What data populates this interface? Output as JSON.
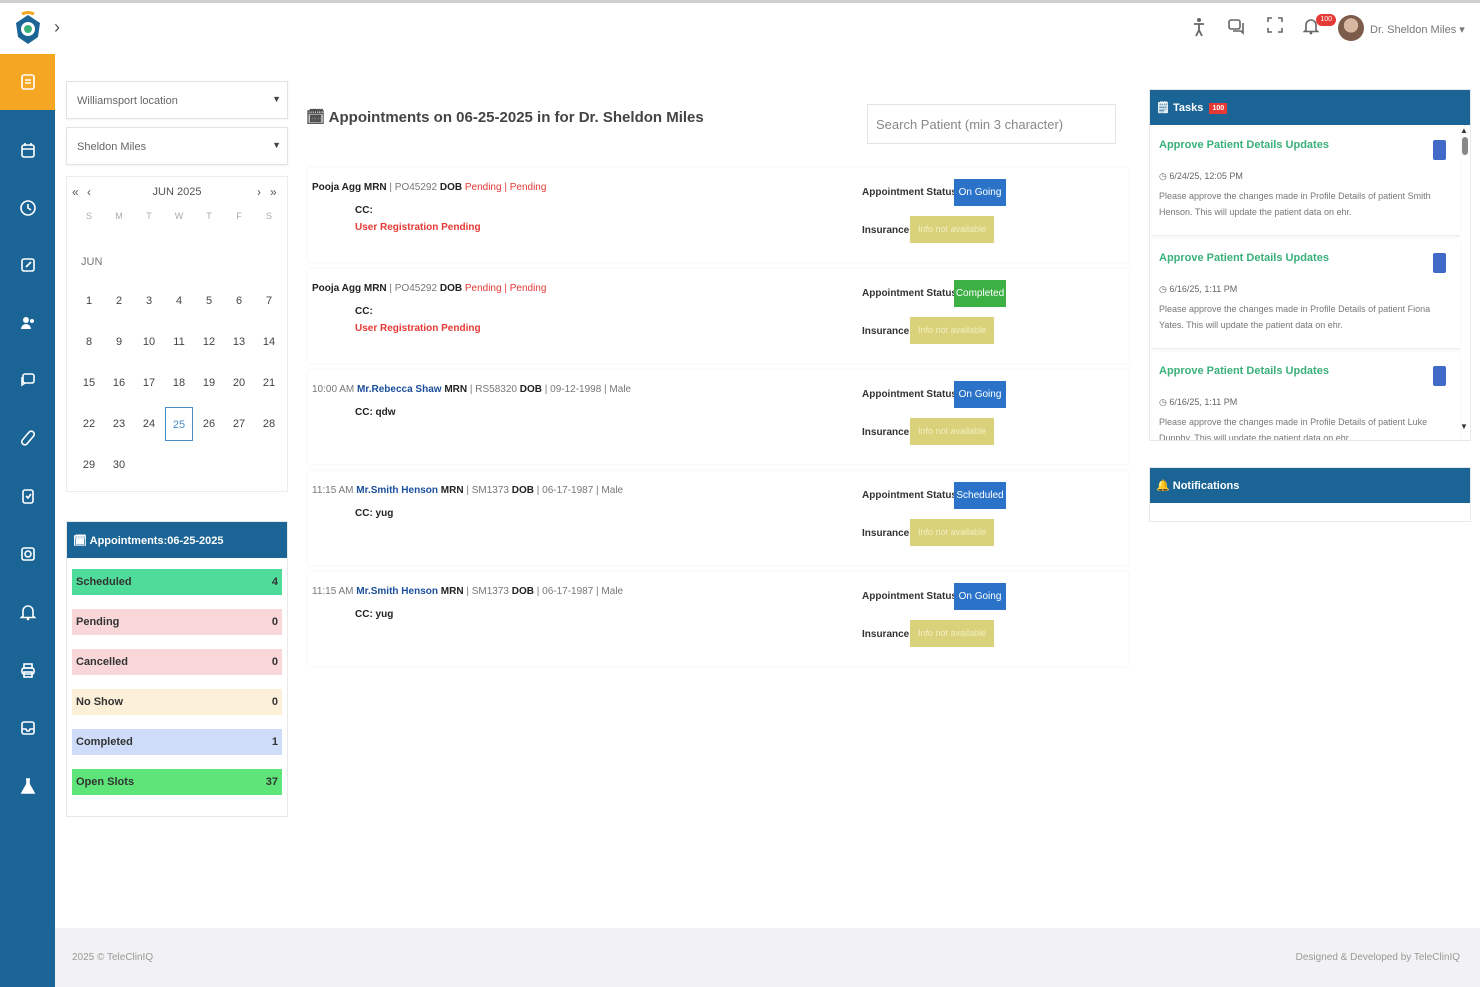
{
  "header": {
    "user_name": "Dr. Sheldon Miles",
    "notification_badge": "100"
  },
  "filters": {
    "location": "Williamsport location",
    "provider": "Sheldon Miles"
  },
  "calendar": {
    "title": "JUN 2025",
    "month_label": "JUN",
    "weekdays": [
      "S",
      "M",
      "T",
      "W",
      "T",
      "F",
      "S"
    ],
    "days": [
      "1",
      "2",
      "3",
      "4",
      "5",
      "6",
      "7",
      "8",
      "9",
      "10",
      "11",
      "12",
      "13",
      "14",
      "15",
      "16",
      "17",
      "18",
      "19",
      "20",
      "21",
      "22",
      "23",
      "24",
      "25",
      "26",
      "27",
      "28",
      "29",
      "30"
    ],
    "selected_day": "25"
  },
  "summary": {
    "title": "Appointments:06-25-2025",
    "rows": [
      {
        "label": "Scheduled",
        "count": "4",
        "color": "#4fdc9b"
      },
      {
        "label": "Pending",
        "count": "0",
        "color": "#f9d6d8"
      },
      {
        "label": "Cancelled",
        "count": "0",
        "color": "#f9d6d8"
      },
      {
        "label": "No Show",
        "count": "0",
        "color": "#fdf0d8"
      },
      {
        "label": "Completed",
        "count": "1",
        "color": "#cfdcf9"
      },
      {
        "label": "Open Slots",
        "count": "37",
        "color": "#5ee57a"
      }
    ]
  },
  "main": {
    "title": "Appointments on 06-25-2025 in for Dr. Sheldon Miles",
    "search_placeholder": "Search Patient (min 3 character)"
  },
  "appointments": [
    {
      "time": "",
      "patient": "Pooja Agg",
      "mrn_label": "MRN",
      "mrn": "| PO45292",
      "dob_label": "DOB",
      "dob": "Pending | Pending",
      "cc": "CC:",
      "note": "User Registration Pending",
      "status_label": "Appointment Status:",
      "status": "On Going",
      "status_color": "#2a73c9",
      "ins_label": "Insurance:",
      "ins": "Info not available"
    },
    {
      "time": "",
      "patient": "Pooja Agg",
      "mrn_label": "MRN",
      "mrn": "| PO45292",
      "dob_label": "DOB",
      "dob": "Pending | Pending",
      "cc": "CC:",
      "note": "User Registration Pending",
      "status_label": "Appointment Status:",
      "status": "Completed",
      "status_color": "#3cb043",
      "ins_label": "Insurance:",
      "ins": "Info not available"
    },
    {
      "time": "10:00 AM",
      "patient": "Mr.Rebecca Shaw",
      "mrn_label": "MRN",
      "mrn": "| RS58320",
      "dob_label": "DOB",
      "dob": "| 09-12-1998 | Male",
      "cc": "CC: qdw",
      "note": "",
      "status_label": "Appointment Status:",
      "status": "On Going",
      "status_color": "#2a73c9",
      "ins_label": "Insurance:",
      "ins": "Info not available"
    },
    {
      "time": "11:15 AM",
      "patient": "Mr.Smith Henson",
      "mrn_label": "MRN",
      "mrn": "| SM1373",
      "dob_label": "DOB",
      "dob": "| 06-17-1987 | Male",
      "cc": "CC: yug",
      "note": "",
      "status_label": "Appointment Status:",
      "status": "Scheduled",
      "status_color": "#2a73c9",
      "ins_label": "Insurance:",
      "ins": "Info not available"
    },
    {
      "time": "11:15 AM",
      "patient": "Mr.Smith Henson",
      "mrn_label": "MRN",
      "mrn": "| SM1373",
      "dob_label": "DOB",
      "dob": "| 06-17-1987 | Male",
      "cc": "CC: yug",
      "note": "",
      "status_label": "Appointment Status:",
      "status": "On Going",
      "status_color": "#2a73c9",
      "ins_label": "Insurance:",
      "ins": "Info not available"
    }
  ],
  "tasks": {
    "title": "Tasks",
    "badge": "100",
    "items": [
      {
        "title": "Approve Patient Details Updates",
        "time": "6/24/25, 12:05 PM",
        "desc": "Please approve the changes made in Profile Details of patient Smith Henson. This will update the patient data on ehr."
      },
      {
        "title": "Approve Patient Details Updates",
        "time": "6/16/25, 1:11 PM",
        "desc": "Please approve the changes made in Profile Details of patient Fiona Yates. This will update the patient data on ehr."
      },
      {
        "title": "Approve Patient Details Updates",
        "time": "6/16/25, 1:11 PM",
        "desc": "Please approve the changes made in Profile Details of patient Luke Dunphy. This will update the patient data on ehr."
      }
    ]
  },
  "notifications": {
    "title": "Notifications"
  },
  "footer": {
    "left": "2025 © TeleClinIQ",
    "right": "Designed & Developed by TeleClinIQ"
  }
}
